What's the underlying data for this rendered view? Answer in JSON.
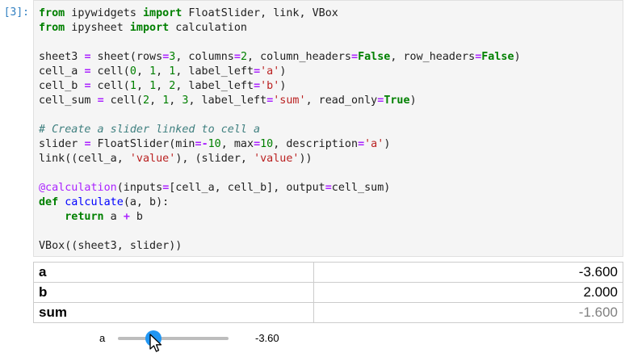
{
  "cell": {
    "prompt": "[3]:",
    "code_lines": [
      [
        [
          "kw",
          "from"
        ],
        [
          "t",
          " ipywidgets "
        ],
        [
          "kw",
          "import"
        ],
        [
          "t",
          " FloatSlider, link, VBox"
        ]
      ],
      [
        [
          "kw",
          "from"
        ],
        [
          "t",
          " ipysheet "
        ],
        [
          "kw",
          "import"
        ],
        [
          "t",
          " calculation"
        ]
      ],
      [],
      [
        [
          "t",
          "sheet3 "
        ],
        [
          "op",
          "="
        ],
        [
          "t",
          " sheet(rows"
        ],
        [
          "op",
          "="
        ],
        [
          "num",
          "3"
        ],
        [
          "t",
          ", columns"
        ],
        [
          "op",
          "="
        ],
        [
          "num",
          "2"
        ],
        [
          "t",
          ", column_headers"
        ],
        [
          "op",
          "="
        ],
        [
          "kw",
          "False"
        ],
        [
          "t",
          ", row_headers"
        ],
        [
          "op",
          "="
        ],
        [
          "kw",
          "False"
        ],
        [
          "t",
          ")"
        ]
      ],
      [
        [
          "t",
          "cell_a "
        ],
        [
          "op",
          "="
        ],
        [
          "t",
          " cell("
        ],
        [
          "num",
          "0"
        ],
        [
          "t",
          ", "
        ],
        [
          "num",
          "1"
        ],
        [
          "t",
          ", "
        ],
        [
          "num",
          "1"
        ],
        [
          "t",
          ", label_left"
        ],
        [
          "op",
          "="
        ],
        [
          "str",
          "'a'"
        ],
        [
          "t",
          ")"
        ]
      ],
      [
        [
          "t",
          "cell_b "
        ],
        [
          "op",
          "="
        ],
        [
          "t",
          " cell("
        ],
        [
          "num",
          "1"
        ],
        [
          "t",
          ", "
        ],
        [
          "num",
          "1"
        ],
        [
          "t",
          ", "
        ],
        [
          "num",
          "2"
        ],
        [
          "t",
          ", label_left"
        ],
        [
          "op",
          "="
        ],
        [
          "str",
          "'b'"
        ],
        [
          "t",
          ")"
        ]
      ],
      [
        [
          "t",
          "cell_sum "
        ],
        [
          "op",
          "="
        ],
        [
          "t",
          " cell("
        ],
        [
          "num",
          "2"
        ],
        [
          "t",
          ", "
        ],
        [
          "num",
          "1"
        ],
        [
          "t",
          ", "
        ],
        [
          "num",
          "3"
        ],
        [
          "t",
          ", label_left"
        ],
        [
          "op",
          "="
        ],
        [
          "str",
          "'sum'"
        ],
        [
          "t",
          ", read_only"
        ],
        [
          "op",
          "="
        ],
        [
          "kw",
          "True"
        ],
        [
          "t",
          ")"
        ]
      ],
      [],
      [
        [
          "cm",
          "# Create a slider linked to cell a"
        ]
      ],
      [
        [
          "t",
          "slider "
        ],
        [
          "op",
          "="
        ],
        [
          "t",
          " FloatSlider(min"
        ],
        [
          "op",
          "="
        ],
        [
          "op",
          "-"
        ],
        [
          "num",
          "10"
        ],
        [
          "t",
          ", max"
        ],
        [
          "op",
          "="
        ],
        [
          "num",
          "10"
        ],
        [
          "t",
          ", description"
        ],
        [
          "op",
          "="
        ],
        [
          "str",
          "'a'"
        ],
        [
          "t",
          ")"
        ]
      ],
      [
        [
          "t",
          "link((cell_a, "
        ],
        [
          "str",
          "'value'"
        ],
        [
          "t",
          "), (slider, "
        ],
        [
          "str",
          "'value'"
        ],
        [
          "t",
          "))"
        ]
      ],
      [],
      [
        [
          "dec",
          "@calculation"
        ],
        [
          "t",
          "(inputs"
        ],
        [
          "op",
          "="
        ],
        [
          "t",
          "[cell_a, cell_b], output"
        ],
        [
          "op",
          "="
        ],
        [
          "t",
          "cell_sum)"
        ]
      ],
      [
        [
          "kw",
          "def"
        ],
        [
          "t",
          " "
        ],
        [
          "fn",
          "calculate"
        ],
        [
          "t",
          "(a, b):"
        ]
      ],
      [
        [
          "t",
          "    "
        ],
        [
          "kw",
          "return"
        ],
        [
          "t",
          " a "
        ],
        [
          "op",
          "+"
        ],
        [
          "t",
          " b"
        ]
      ],
      [],
      [
        [
          "t",
          "VBox((sheet3, slider))"
        ]
      ]
    ]
  },
  "sheet": {
    "rows": [
      {
        "label": "a",
        "value": "-3.600",
        "read_only": false
      },
      {
        "label": "b",
        "value": "2.000",
        "read_only": false
      },
      {
        "label": "sum",
        "value": "-1.600",
        "read_only": true
      }
    ]
  },
  "slider": {
    "description": "a",
    "min": -10,
    "max": 10,
    "value": -3.6,
    "readout": "-3.60",
    "handle_color": "#2196f3",
    "track_color": "#bdbdbd"
  }
}
